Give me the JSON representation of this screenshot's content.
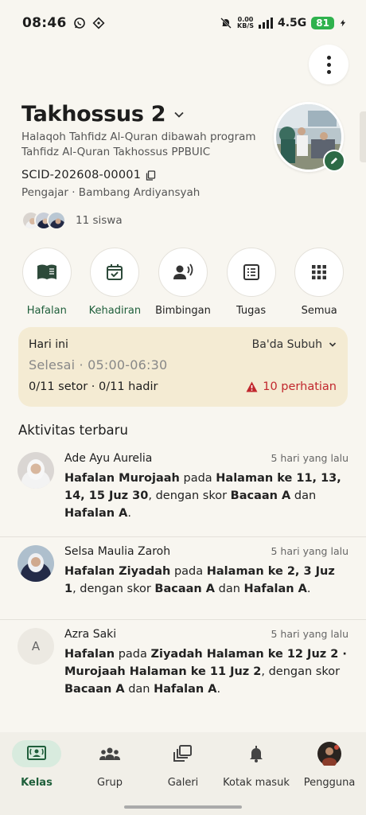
{
  "status_bar": {
    "time": "08:46",
    "net_speed_top": "0.00",
    "net_speed_bottom": "KB/S",
    "network": "4.5G",
    "battery": "81"
  },
  "header": {
    "title": "Takhossus 2",
    "description": "Halaqoh Tahfidz Al-Quran dibawah program Tahfidz Al-Quran Takhossus PPBUIC",
    "scid": "SCID-202608-00001",
    "teacher": "Pengajar · Bambang Ardiyansyah",
    "student_count": "11 siswa"
  },
  "actions": [
    {
      "label": "Hafalan",
      "icon": "book-icon"
    },
    {
      "label": "Kehadiran",
      "icon": "calendar-check-icon"
    },
    {
      "label": "Bimbingan",
      "icon": "voice-person-icon"
    },
    {
      "label": "Tugas",
      "icon": "checklist-icon"
    },
    {
      "label": "Semua",
      "icon": "grid-icon"
    }
  ],
  "today": {
    "label": "Hari ini",
    "session": "Ba'da Subuh",
    "status": "Selesai · 05:00-06:30",
    "summary": "0/11 setor · 0/11 hadir",
    "alert": "10 perhatian"
  },
  "activities": {
    "title": "Aktivitas terbaru",
    "items": [
      {
        "name": "Ade Ayu Aurelia",
        "time": "5 hari yang lalu",
        "parts": [
          "Hafalan Murojaah",
          " pada ",
          "Halaman ke 11, 13, 14, 15 Juz 30",
          ", dengan skor ",
          "Bacaan A",
          " dan ",
          "Hafalan A",
          "."
        ]
      },
      {
        "name": "Selsa Maulia Zaroh",
        "time": "5 hari yang lalu",
        "parts": [
          "Hafalan Ziyadah",
          " pada ",
          "Halaman ke 2, 3 Juz 1",
          ", dengan skor ",
          "Bacaan A",
          " dan ",
          "Hafalan A",
          "."
        ]
      },
      {
        "name": "Azra Saki",
        "initial": "A",
        "time": "5 hari yang lalu",
        "parts": [
          "Hafalan",
          " pada ",
          "Ziyadah Halaman ke 12 Juz 2 · Murojaah Halaman ke 11 Juz 2",
          ", dengan skor ",
          "Bacaan A",
          " dan ",
          "Hafalan A",
          "."
        ]
      }
    ]
  },
  "nav": [
    {
      "label": "Kelas",
      "icon": "class-screen-icon",
      "active": true
    },
    {
      "label": "Grup",
      "icon": "group-icon"
    },
    {
      "label": "Galeri",
      "icon": "gallery-icon"
    },
    {
      "label": "Kotak masuk",
      "icon": "bell-icon"
    },
    {
      "label": "Pengguna",
      "icon": "user-avatar"
    }
  ],
  "colors": {
    "accent": "#1f5f3b",
    "alert": "#c1272d",
    "card": "#f4ebd3",
    "background": "#f8f6f0"
  }
}
